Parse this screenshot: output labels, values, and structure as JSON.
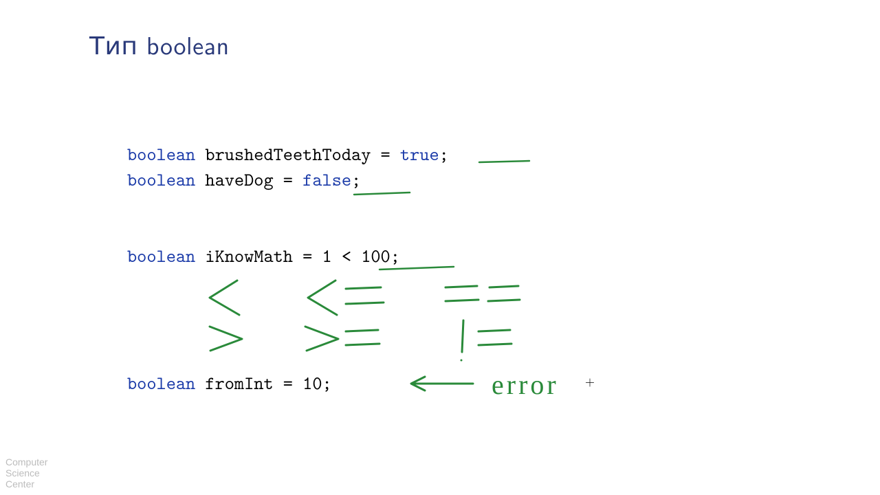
{
  "title": "Тип boolean",
  "code": {
    "kw": "boolean",
    "line1_var": " brushedTeethToday = ",
    "line1_val": "true",
    "semicolon": ";",
    "line2_var": " haveDog = ",
    "line2_val": "false",
    "line3_var": " iKnowMath = 1 < 100;",
    "line4_var": " fromInt = 10;"
  },
  "handwriting": {
    "operators_row1": [
      "<",
      "<=",
      "=="
    ],
    "operators_row2": [
      ">",
      ">=",
      "!="
    ],
    "error_label": "error"
  },
  "logo": {
    "l1": "Computer",
    "l2": "Science",
    "l3": "Center"
  },
  "colors": {
    "title": "#2a3a7a",
    "keyword": "#1a3aa8",
    "pen": "#2a8a3a"
  }
}
